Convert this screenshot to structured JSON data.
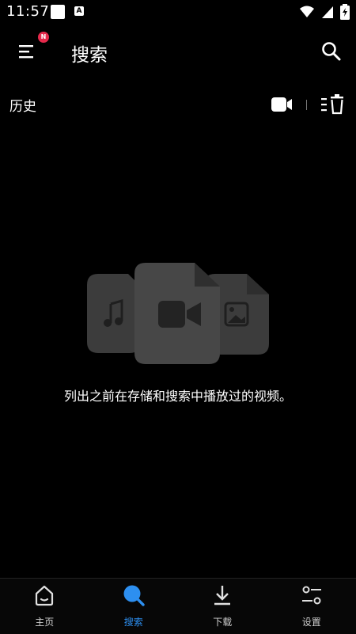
{
  "status_bar": {
    "time": "11:57",
    "a_label": "A"
  },
  "app_bar": {
    "title": "搜索",
    "menu_badge": "N"
  },
  "history": {
    "title": "历史"
  },
  "empty_state": {
    "message": "列出之前在存储和搜索中播放过的视频。"
  },
  "bottom_nav": {
    "items": [
      {
        "label": "主页",
        "icon": "home-icon",
        "active": false
      },
      {
        "label": "搜索",
        "icon": "search-icon",
        "active": true
      },
      {
        "label": "下载",
        "icon": "download-icon",
        "active": false
      },
      {
        "label": "设置",
        "icon": "settings-icon",
        "active": false
      }
    ]
  },
  "colors": {
    "background": "#000000",
    "accent": "#2d8ff0",
    "badge": "#e5294b",
    "illustration": "#3f3f3f"
  }
}
